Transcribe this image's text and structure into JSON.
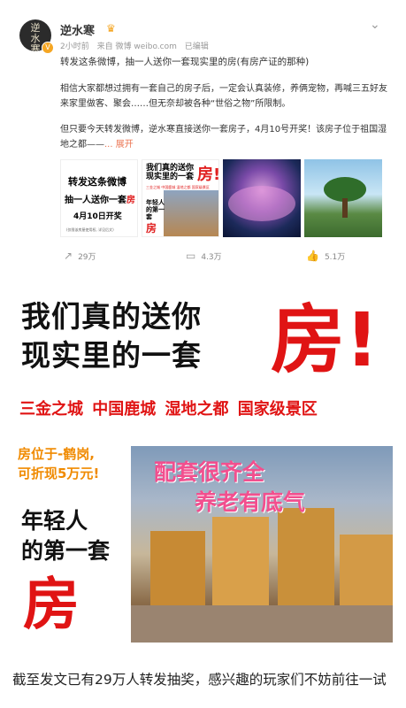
{
  "post": {
    "avatar_text": "逆水寒",
    "username": "逆水寒",
    "crown_icon": "crown-emoji-icon",
    "time": "2小时前",
    "source": "来自 微博 weibo.com",
    "edited": "已编辑",
    "line1": "转发这条微博，抽一人送你一套现实里的房(有房产证的那种)",
    "para1": "相信大家都想过拥有一套自己的房子后，一定会认真装修，养俩宠物，再喊三五好友来家里做客、聚会……但无奈却被各种“世俗之物”所限制。",
    "para2": "但只要今天转发微博，逆水寒直接送你一套房子，4月10号开奖！该房子位于祖国湿地之都——",
    "more": "... 展开"
  },
  "thumbs": {
    "t1": {
      "a": "转发这条微博",
      "b1": "抽一人送你一套",
      "b2": "房",
      "c": "4月10日开奖",
      "d": "(仅限该房屋使用权, 详见后文)"
    },
    "t2": {
      "a": "我们真的送你现实里的一套",
      "r": "房!",
      "m": "三金之城 中国鹿城 湿地之都 国家级景区",
      "s": "年轻人的第一套",
      "r2": "房"
    }
  },
  "actions": {
    "repost": "29万",
    "comment": "4.3万",
    "like": "5.1万"
  },
  "poster": {
    "headline1": "我们真的送你",
    "headline2": "现实里的一套",
    "fang": "房!",
    "tags": "三金之城 中国鹿城 湿地之都 国家级景区",
    "loc1": "房位于-鹤岗,",
    "loc2": "可折现5万元!",
    "young1": "年轻人",
    "young2": "的第一套",
    "fang2": "房",
    "photo1": "配套很齐全",
    "photo2": "养老有底气"
  },
  "caption": "截至发文已有29万人转发抽奖，感兴趣的玩家们不妨前往一试"
}
